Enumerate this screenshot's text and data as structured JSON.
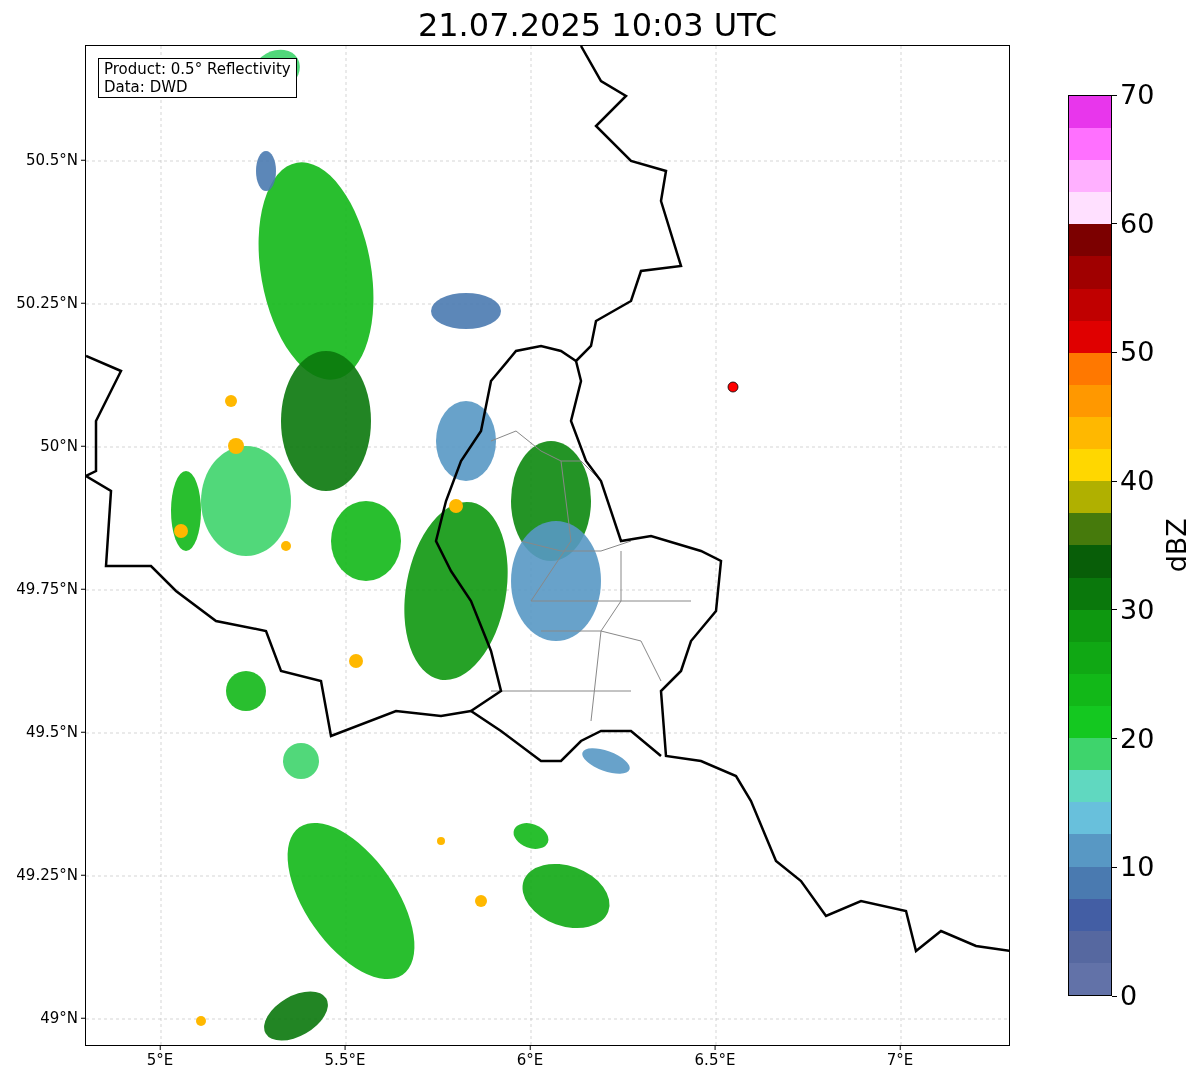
{
  "title": "21.07.2025 10:03 UTC",
  "info_box": {
    "lines": [
      "Product: 0.5° Reflectivity",
      "Data: DWD"
    ]
  },
  "y_ticks": [
    "50.5°N",
    "50.25°N",
    "50°N",
    "49.75°N",
    "49.5°N",
    "49.25°N",
    "49°N"
  ],
  "x_ticks": [
    "5°E",
    "5.5°E",
    "6°E",
    "6.5°E",
    "7°E"
  ],
  "colorbar": {
    "ticks": [
      "70",
      "60",
      "50",
      "40",
      "30",
      "20",
      "10",
      "0"
    ],
    "label": "dBZ"
  }
}
